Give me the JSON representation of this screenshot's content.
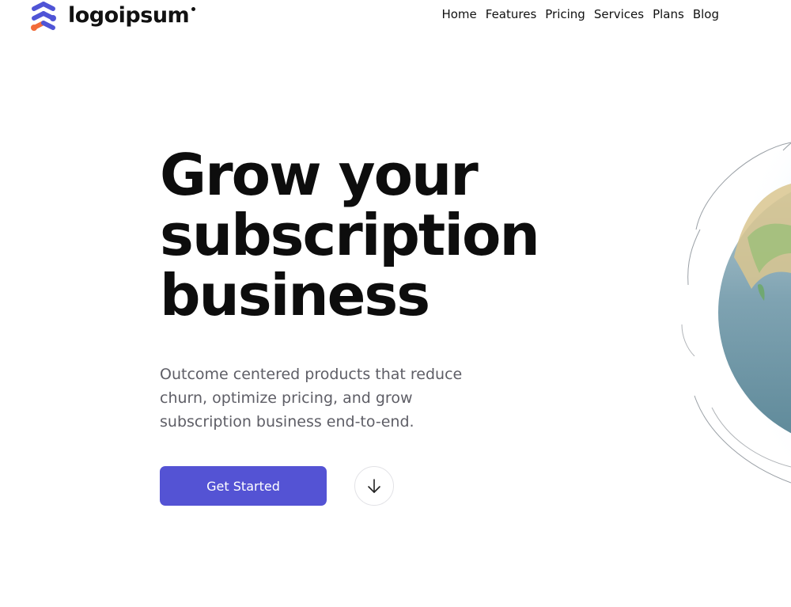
{
  "header": {
    "logo_text": "logoipsum",
    "nav": [
      {
        "label": "Home"
      },
      {
        "label": "Features"
      },
      {
        "label": "Pricing"
      },
      {
        "label": "Services"
      },
      {
        "label": "Plans"
      },
      {
        "label": "Blog"
      }
    ]
  },
  "hero": {
    "title_lines": [
      "Grow your",
      "subscription",
      "business"
    ],
    "subtitle": "Outcome centered products that reduce churn, optimize pricing, and grow subscription business end-to-end.",
    "cta_label": "Get Started",
    "scroll_icon": "arrow-down-icon"
  },
  "colors": {
    "accent": "#5453d4",
    "logo_blue": "#4f54d6",
    "logo_orange": "#f26b3a",
    "subtitle": "#5e5e66"
  },
  "illustration": {
    "icon": "globe-icon"
  }
}
